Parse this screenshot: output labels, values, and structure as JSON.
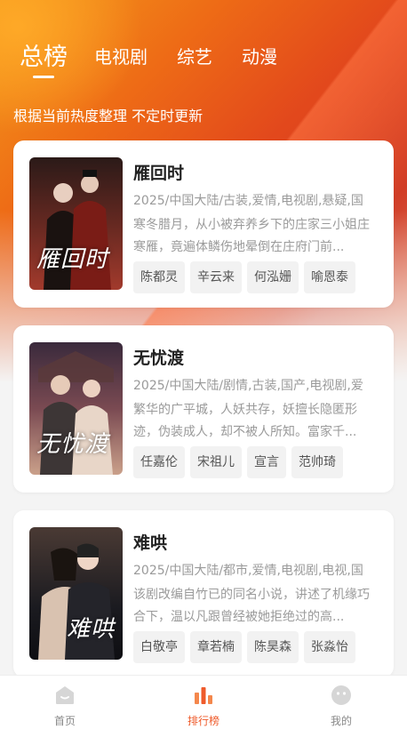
{
  "tabs": [
    {
      "label": "总榜",
      "active": true
    },
    {
      "label": "电视剧",
      "active": false
    },
    {
      "label": "综艺",
      "active": false
    },
    {
      "label": "动漫",
      "active": false
    }
  ],
  "subtitle": "根据当前热度整理 不定时更新",
  "items": [
    {
      "title": "雁回时",
      "meta": "2025/中国大陆/古装,爱情,电视剧,悬疑,国",
      "desc": "寒冬腊月，从小被弃养乡下的庄家三小姐庄寒雁，竟遍体鳞伤地晕倒在庄府门前...",
      "actors": [
        "陈都灵",
        "辛云来",
        "何泓姗",
        "喻恩泰"
      ],
      "poster_text": "雁回时",
      "poster_colors": [
        "#2b1a18",
        "#6b2a22",
        "#a23a2c"
      ]
    },
    {
      "title": "无忧渡",
      "meta": "2025/中国大陆/剧情,古装,国产,电视剧,爱",
      "desc": "繁华的广平城，人妖共存，妖擅长隐匿形迹，伪装成人，却不被人所知。富家千...",
      "actors": [
        "任嘉伦",
        "宋祖儿",
        "宣言",
        "范帅琦"
      ],
      "poster_text": "无忧渡",
      "poster_colors": [
        "#3a2a3c",
        "#7a4a52",
        "#caa08a"
      ]
    },
    {
      "title": "难哄",
      "meta": "2025/中国大陆/都市,爱情,电视剧,电视,国",
      "desc": "该剧改编自竹已的同名小说，讲述了机缘巧合下，温以凡跟曾经被她拒绝过的高...",
      "actors": [
        "白敬亭",
        "章若楠",
        "陈昊森",
        "张淼怡"
      ],
      "poster_text": "难哄",
      "poster_colors": [
        "#1b1b20",
        "#4a3a34",
        "#b88a6a"
      ]
    }
  ],
  "nav": [
    {
      "label": "首页",
      "icon": "home-icon",
      "active": false
    },
    {
      "label": "排行榜",
      "icon": "ranking-icon",
      "active": true
    },
    {
      "label": "我的",
      "icon": "profile-icon",
      "active": false
    }
  ],
  "colors": {
    "accent": "#ef5b2b",
    "inactive_icon": "#d6d6d6"
  }
}
